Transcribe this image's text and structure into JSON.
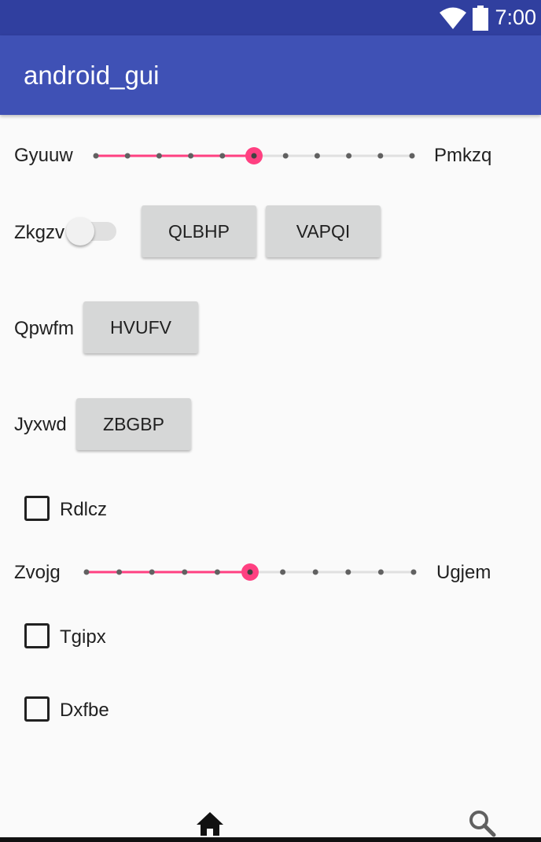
{
  "status_bar": {
    "time": "7:00",
    "icons": [
      "wifi-icon",
      "battery-icon"
    ],
    "background": "#303f9f"
  },
  "app_bar": {
    "title": "android_gui",
    "background": "#3f51b5"
  },
  "slider1": {
    "start_label": "Gyuuw",
    "end_label": "Pmkzq",
    "steps": 10,
    "value": 5,
    "accent": "#ff4081"
  },
  "row2": {
    "switch_label": "Zkgzv",
    "switch_on": false,
    "button1": "QLBHP",
    "button2": "VAPQI"
  },
  "row3": {
    "label": "Qpwfm",
    "button": "HVUFV"
  },
  "row4": {
    "label": "Jyxwd",
    "button": "ZBGBP"
  },
  "checkbox1": {
    "label": "Rdlcz",
    "checked": false
  },
  "slider2": {
    "start_label": "Zvojg",
    "end_label": "Ugjem",
    "steps": 10,
    "value": 5,
    "accent": "#ff4081"
  },
  "checkbox2": {
    "label": "Tgipx",
    "checked": false
  },
  "checkbox3": {
    "label": "Dxfbe",
    "checked": false
  },
  "bottom_nav": {
    "items": [
      "home-icon",
      "search-icon"
    ]
  }
}
